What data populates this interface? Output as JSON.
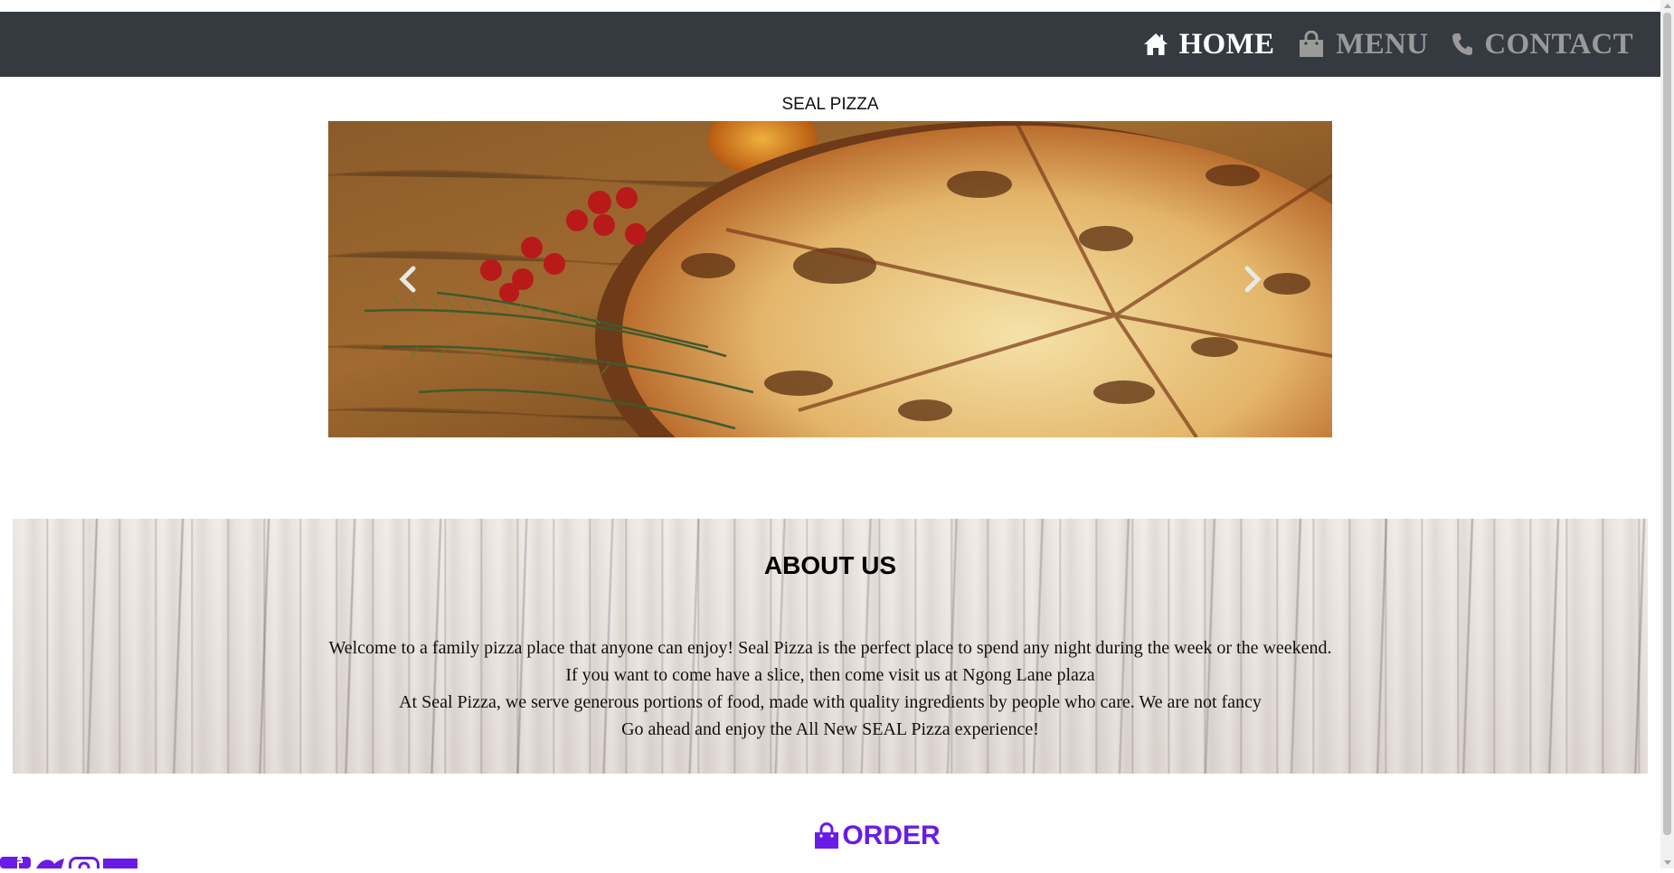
{
  "nav": {
    "items": [
      {
        "label": "HOME",
        "icon": "home-icon",
        "active": true
      },
      {
        "label": "MENU",
        "icon": "shopping-bag-icon",
        "active": false
      },
      {
        "label": "CONTACT",
        "icon": "phone-icon",
        "active": false
      }
    ]
  },
  "site_title": "SEAL PIZZA",
  "carousel": {
    "image": "pizza-on-wooden-board",
    "prev_icon": "chevron-left-icon",
    "next_icon": "chevron-right-icon"
  },
  "about": {
    "heading": "ABOUT US",
    "lines": [
      "Welcome to a family pizza place that anyone can enjoy! Seal Pizza is the perfect place to spend any night during the week or the weekend.",
      "If you want to come have a slice, then come visit us at Ngong Lane plaza",
      "At Seal Pizza, we serve generous portions of food, made with quality ingredients by people who care. We are not fancy",
      "Go ahead and enjoy the All New SEAL Pizza experience!"
    ]
  },
  "order": {
    "label": "ORDER",
    "icon": "shopping-bag-icon"
  },
  "social": [
    "facebook-icon",
    "twitter-icon",
    "instagram-icon",
    "email-icon"
  ],
  "colors": {
    "navbar": "#343a40",
    "nav_active": "#ffffff",
    "nav_inactive": "#9a9a9a",
    "accent": "#6a1be6"
  }
}
